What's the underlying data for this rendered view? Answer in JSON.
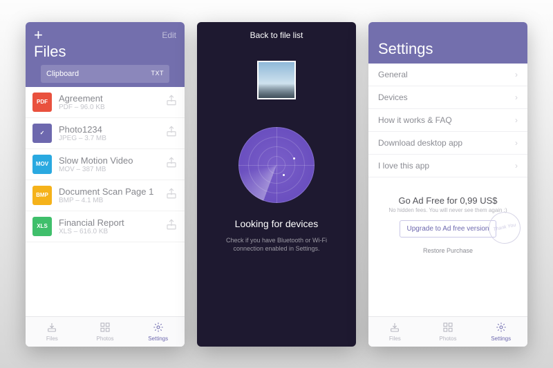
{
  "colors": {
    "accent": "#736fad",
    "dark_bg": "#1e1930",
    "radar": "#6f55c4"
  },
  "files": {
    "add_label": "+",
    "edit_label": "Edit",
    "title": "Files",
    "clipboard": {
      "label": "Clipboard",
      "ext": "TXT"
    },
    "items": [
      {
        "name": "Agreement",
        "sub": "PDF – 96.0 KB",
        "badge": "PDF",
        "badge_color": "#e9513e"
      },
      {
        "name": "Photo1234",
        "sub": "JPEG – 3.7 MB",
        "badge": "✓",
        "badge_color": "#6d68ae"
      },
      {
        "name": "Slow Motion Video",
        "sub": "MOV – 387 MB",
        "badge": "MOV",
        "badge_color": "#2aa9e0"
      },
      {
        "name": "Document Scan Page 1",
        "sub": "BMP – 4.1 MB",
        "badge": "BMP",
        "badge_color": "#f5b21a"
      },
      {
        "name": "Financial Report",
        "sub": "XLS – 616.0 KB",
        "badge": "XLS",
        "badge_color": "#3fbf6b"
      }
    ]
  },
  "radar": {
    "back": "Back to file list",
    "status": "Looking for devices",
    "hint": "Check if you have Bluetooth or Wi-Fi connection enabled in Settings."
  },
  "settings": {
    "title": "Settings",
    "rows": [
      {
        "label": "General"
      },
      {
        "label": "Devices"
      },
      {
        "label": "How it works & FAQ"
      },
      {
        "label": "Download desktop app"
      },
      {
        "label": "I love this app"
      }
    ],
    "promo": {
      "title": "Go Ad Free for 0,99 US$",
      "sub": "No hidden fees. You will never see them again :)",
      "button": "Upgrade to Ad free version",
      "stamp": "Thank You"
    },
    "restore": "Restore Purchase"
  },
  "tabs": [
    {
      "label": "Files"
    },
    {
      "label": "Photos"
    },
    {
      "label": "Settings"
    }
  ]
}
